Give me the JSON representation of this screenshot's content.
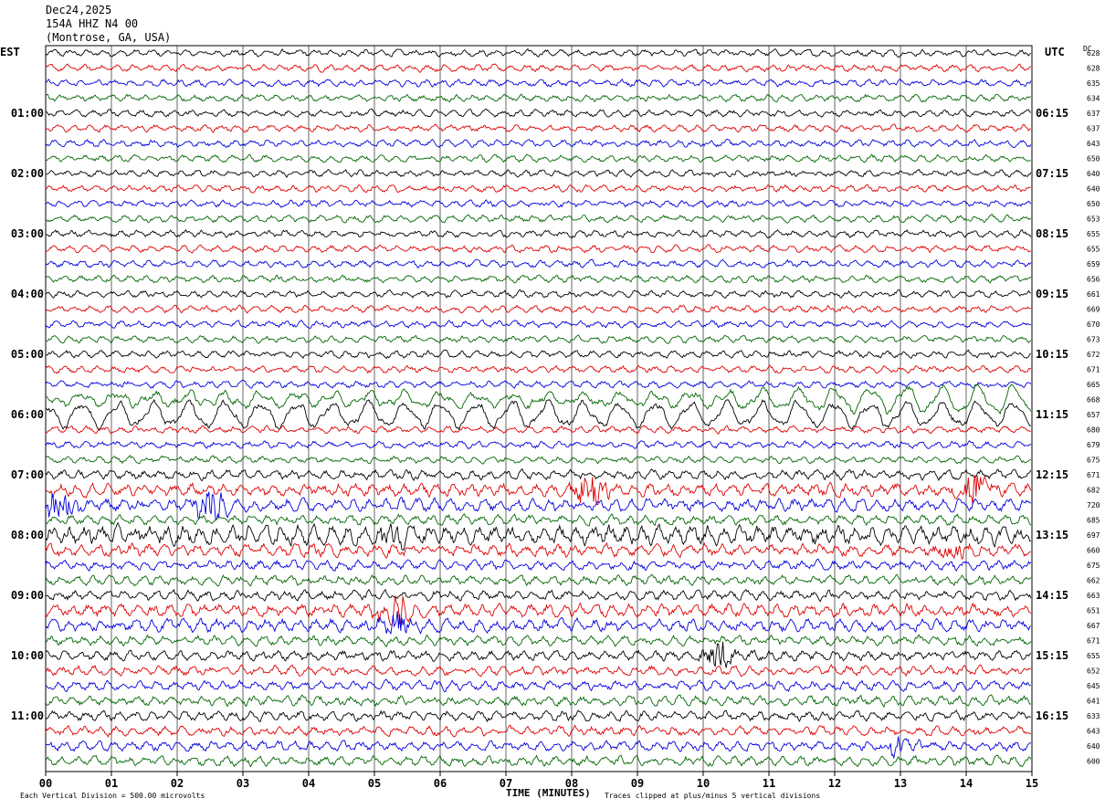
{
  "header": {
    "date": "Dec24,2025",
    "station": "154A HHZ N4 00",
    "location": "(Montrose, GA, USA)"
  },
  "left_zone": "EST",
  "right_zone": "UTC",
  "dc_label": "DC",
  "footer": {
    "xlabel": "TIME (MINUTES)",
    "scale_note": "Each Vertical Division =  500.00 microvolts",
    "clip_note": "Traces clipped at plus/minus 5 vertical divisions"
  },
  "colors": {
    "trace_cycle": [
      "#000000",
      "#dd0000",
      "#0000dd",
      "#006600"
    ],
    "grid": "#000000",
    "background": "#ffffff"
  },
  "chart_data": {
    "type": "line",
    "subtype": "helicorder",
    "xlabel": "TIME (MINUTES)",
    "xlim": [
      0,
      15
    ],
    "x_ticks": [
      "00",
      "01",
      "02",
      "03",
      "04",
      "05",
      "06",
      "07",
      "08",
      "09",
      "10",
      "11",
      "12",
      "13",
      "14",
      "15"
    ],
    "left_hour_labels": [
      "01:00",
      "02:00",
      "03:00",
      "04:00",
      "05:00",
      "06:00",
      "07:00",
      "08:00",
      "09:00",
      "10:00",
      "11:00"
    ],
    "right_hour_labels": [
      "06:15",
      "07:15",
      "08:15",
      "09:15",
      "10:15",
      "11:15",
      "12:15",
      "13:15",
      "14:15",
      "15:15",
      "16:15"
    ],
    "hour_label_rows": [
      4,
      8,
      12,
      16,
      20,
      24,
      28,
      32,
      36,
      40,
      44
    ],
    "dc_offsets": [
      628,
      628,
      635,
      634,
      637,
      637,
      643,
      650,
      640,
      640,
      650,
      653,
      655,
      655,
      659,
      656,
      661,
      669,
      670,
      673,
      672,
      671,
      665,
      668,
      657,
      680,
      679,
      675,
      671,
      682,
      720,
      685,
      697,
      660,
      675,
      662,
      663,
      651,
      667,
      671,
      655,
      652,
      645,
      641,
      633,
      643,
      640,
      600
    ],
    "row_amplitude_level": [
      1,
      1,
      1,
      1,
      1,
      1,
      1,
      1,
      1,
      1,
      1,
      1,
      1,
      1,
      1,
      1,
      1,
      1,
      1,
      1,
      1,
      1,
      1,
      2,
      2,
      1,
      1,
      1,
      2,
      3,
      3,
      2,
      5,
      3,
      2,
      2,
      2,
      3,
      3,
      2,
      2,
      2,
      2,
      2,
      2,
      2,
      2,
      2
    ],
    "long_period_rows": [
      23,
      24
    ],
    "event_bursts": [
      {
        "row": 29,
        "minute": 8.3,
        "strength": 4
      },
      {
        "row": 29,
        "minute": 14.1,
        "strength": 4
      },
      {
        "row": 30,
        "minute": 2.5,
        "strength": 4
      },
      {
        "row": 30,
        "minute": 0.2,
        "strength": 3
      },
      {
        "row": 32,
        "minute": 5.3,
        "strength": 3
      },
      {
        "row": 33,
        "minute": 13.8,
        "strength": 2
      },
      {
        "row": 37,
        "minute": 5.3,
        "strength": 5
      },
      {
        "row": 38,
        "minute": 5.3,
        "strength": 3
      },
      {
        "row": 40,
        "minute": 10.2,
        "strength": 3
      },
      {
        "row": 46,
        "minute": 13.0,
        "strength": 2
      }
    ]
  }
}
